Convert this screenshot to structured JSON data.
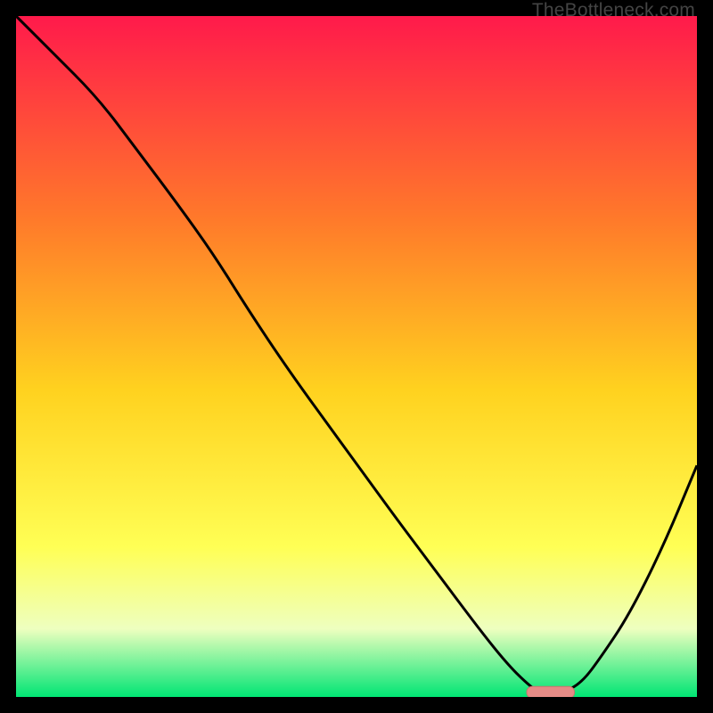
{
  "watermark": "TheBottleneck.com",
  "colors": {
    "frame": "#000000",
    "gradient_top": "#ff1a4b",
    "gradient_mid1": "#ff7a2a",
    "gradient_mid2": "#ffd21f",
    "gradient_mid3": "#ffff55",
    "gradient_mid4": "#eeffbf",
    "gradient_bottom": "#00e574",
    "curve": "#000000",
    "marker_fill": "#e58b86",
    "marker_stroke": "#c9726d"
  },
  "chart_data": {
    "type": "line",
    "title": "",
    "xlabel": "",
    "ylabel": "",
    "xlim": [
      0,
      100
    ],
    "ylim": [
      0,
      100
    ],
    "x": [
      0,
      5,
      12,
      18,
      24,
      29,
      34,
      40,
      48,
      56,
      62,
      68,
      72,
      75,
      77,
      80,
      83,
      86,
      90,
      95,
      100
    ],
    "values": [
      100,
      95,
      88,
      80,
      72,
      65,
      57,
      48,
      37,
      26,
      18,
      10,
      5,
      2,
      0.5,
      0.5,
      2,
      6,
      12,
      22,
      34
    ],
    "marker": {
      "x_start": 75,
      "x_end": 82,
      "y": 0.5
    }
  }
}
